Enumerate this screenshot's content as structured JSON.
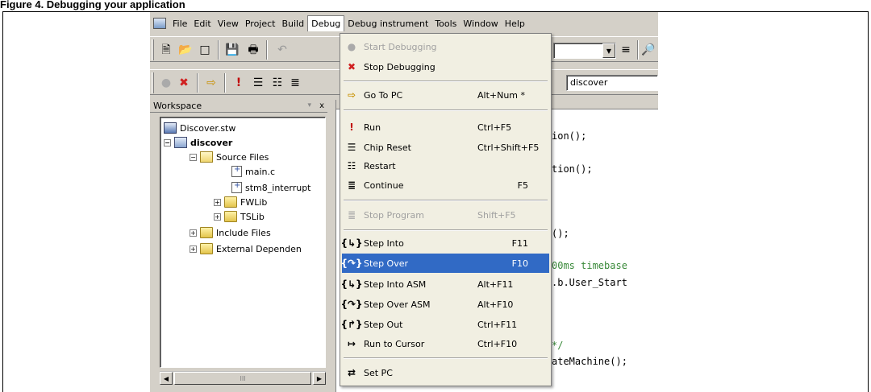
{
  "caption": "Figure 4. Debugging your application",
  "menubar": {
    "items": [
      "File",
      "Edit",
      "View",
      "Project",
      "Build",
      "Debug",
      "Debug instrument",
      "Tools",
      "Window",
      "Help"
    ],
    "active": "Debug"
  },
  "toolbar": {
    "combo_value": "discover"
  },
  "workspace": {
    "title": "Workspace",
    "close": "x",
    "pin": "▾",
    "tree": [
      {
        "label": "Discover.stw",
        "bold": false
      },
      {
        "label": "discover",
        "bold": true
      },
      {
        "label": "Source Files",
        "bold": false
      },
      {
        "label": "main.c",
        "bold": false
      },
      {
        "label": "stm8_interrupt",
        "bold": false
      },
      {
        "label": "FWLib",
        "bold": false
      },
      {
        "label": "TSLib",
        "bold": false
      },
      {
        "label": "Include Files",
        "bold": false
      },
      {
        "label": "External Dependen",
        "bold": false
      }
    ],
    "scroll_grip": "III"
  },
  "editor": {
    "lines": [
      {
        "text": "ion();",
        "comment": false
      },
      {
        "text": "tion();",
        "comment": false
      },
      {
        "text": "();",
        "comment": false
      },
      {
        "text": "00ms timebase",
        "comment": true
      },
      {
        "text": ".b.User_Start",
        "comment": false
      },
      {
        "text": "*/",
        "comment": true
      },
      {
        "text": "ateMachine();",
        "comment": false
      }
    ]
  },
  "debug_menu": {
    "items": [
      {
        "label": "Start Debugging",
        "shortcut": "",
        "icon": "start-debugging-icon",
        "disabled": true
      },
      {
        "label": "Stop Debugging",
        "shortcut": "",
        "icon": "stop-debugging-icon",
        "disabled": false
      },
      {
        "label": "Go To PC",
        "shortcut": "Alt+Num *",
        "icon": "go-to-pc-icon",
        "disabled": false
      },
      {
        "label": "Run",
        "shortcut": "Ctrl+F5",
        "icon": "run-icon",
        "disabled": false
      },
      {
        "label": "Chip Reset",
        "shortcut": "Ctrl+Shift+F5",
        "icon": "chip-reset-icon",
        "disabled": false
      },
      {
        "label": "Restart",
        "shortcut": "",
        "icon": "restart-icon",
        "disabled": false
      },
      {
        "label": "Continue",
        "shortcut": "F5",
        "icon": "continue-icon",
        "disabled": false
      },
      {
        "label": "Stop Program",
        "shortcut": "Shift+F5",
        "icon": "stop-program-icon",
        "disabled": true
      },
      {
        "label": "Step Into",
        "shortcut": "F11",
        "icon": "step-into-icon",
        "disabled": false
      },
      {
        "label": "Step Over",
        "shortcut": "F10",
        "icon": "step-over-icon",
        "disabled": false,
        "selected": true
      },
      {
        "label": "Step Into ASM",
        "shortcut": "Alt+F11",
        "icon": "step-into-asm-icon",
        "disabled": false
      },
      {
        "label": "Step Over ASM",
        "shortcut": "Alt+F10",
        "icon": "step-over-asm-icon",
        "disabled": false
      },
      {
        "label": "Step Out",
        "shortcut": "Ctrl+F11",
        "icon": "step-out-icon",
        "disabled": false
      },
      {
        "label": "Run to Cursor",
        "shortcut": "Ctrl+F10",
        "icon": "run-to-cursor-icon",
        "disabled": false
      },
      {
        "label": "Set PC",
        "shortcut": "",
        "icon": "set-pc-icon",
        "disabled": false
      }
    ]
  },
  "colors": {
    "selection": "#316ac5",
    "menu_bg": "#f1efe2",
    "chrome": "#d4d0c8",
    "comment": "#3a8a3a"
  }
}
